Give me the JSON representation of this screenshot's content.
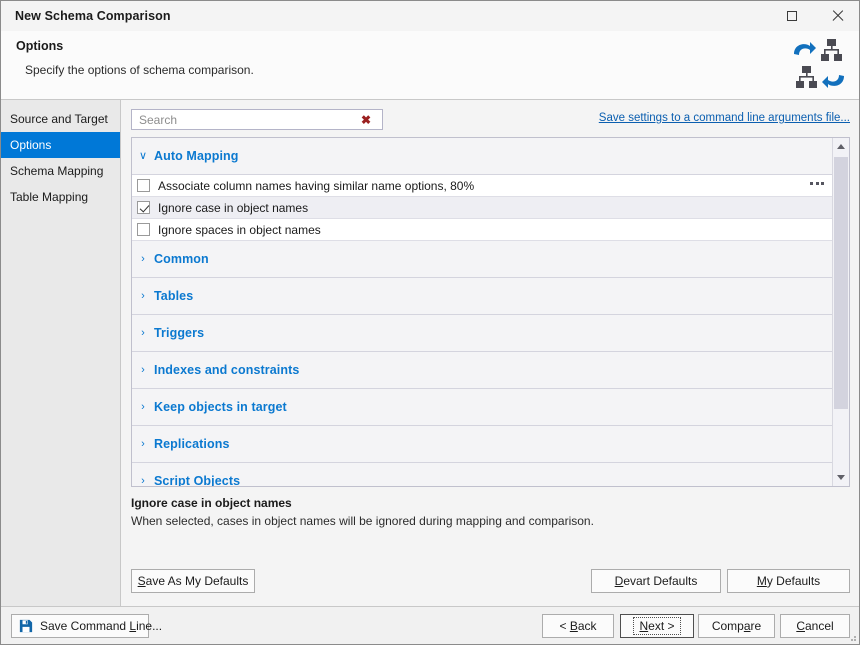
{
  "titlebar": {
    "title": "New Schema Comparison",
    "maximize_icon": "maximize-icon",
    "close_icon": "close-icon"
  },
  "header": {
    "title": "Options",
    "subtitle": "Specify the options of schema comparison.",
    "logo_icon": "schema-comparison-icon"
  },
  "sidebar": {
    "items": [
      {
        "label": "Source and Target",
        "active": false
      },
      {
        "label": "Options",
        "active": true
      },
      {
        "label": "Schema Mapping",
        "active": false
      },
      {
        "label": "Table Mapping",
        "active": false
      }
    ]
  },
  "toolbar": {
    "search": {
      "value": "",
      "placeholder": "Search",
      "clear_glyph": "✖"
    },
    "command_line_link": "Save settings to a command line arguments file..."
  },
  "options": {
    "groups": [
      {
        "label": "Auto Mapping",
        "expanded": true,
        "chevron": "∨",
        "rows": [
          {
            "label": "Associate column names having similar name options, 80%",
            "checked": false,
            "selected": false,
            "has_ellipsis": true
          },
          {
            "label": "Ignore case in object names",
            "checked": true,
            "selected": true,
            "has_ellipsis": false
          },
          {
            "label": "Ignore spaces in object names",
            "checked": false,
            "selected": false,
            "has_ellipsis": false
          }
        ]
      },
      {
        "label": "Common",
        "expanded": false,
        "chevron": "›",
        "rows": []
      },
      {
        "label": "Tables",
        "expanded": false,
        "chevron": "›",
        "rows": []
      },
      {
        "label": "Triggers",
        "expanded": false,
        "chevron": "›",
        "rows": []
      },
      {
        "label": "Indexes and constraints",
        "expanded": false,
        "chevron": "›",
        "rows": []
      },
      {
        "label": "Keep objects in target",
        "expanded": false,
        "chevron": "›",
        "rows": []
      },
      {
        "label": "Replications",
        "expanded": false,
        "chevron": "›",
        "rows": []
      },
      {
        "label": "Script Objects",
        "expanded": false,
        "chevron": "›",
        "rows": []
      }
    ],
    "scrollbar": {
      "up_icon": "scroll-up-icon",
      "down_icon": "scroll-down-icon"
    }
  },
  "description": {
    "title": "Ignore case in object names",
    "text": "When selected, cases in object names will be ignored during mapping and comparison."
  },
  "defaults_buttons": {
    "save_as_my_defaults": "Save As My Defaults",
    "save_as_my_defaults_accel": "S",
    "save_as_my_defaults_rest": "ave As My Defaults",
    "devart_defaults_accel": "D",
    "devart_defaults_pre": "",
    "devart_defaults_rest": "evart Defaults",
    "my_defaults_accel": "M",
    "my_defaults_rest": "y Defaults"
  },
  "footer": {
    "save_command_line_pre": "Save Command ",
    "save_command_line_accel": "L",
    "save_command_line_rest": "ine...",
    "save_icon": "save-floppy-icon",
    "back_pre": "< ",
    "back_accel": "B",
    "back_rest": "ack",
    "next_accel": "N",
    "next_rest": "ext >",
    "compare_pre": "Comp",
    "compare_accel": "a",
    "compare_rest": "re",
    "cancel_accel": "C",
    "cancel_rest": "ancel"
  },
  "colors": {
    "accent_blue": "#0078d7",
    "group_blue": "#0b79d0",
    "link_blue": "#0b5fb0",
    "clear_red": "#9b2020"
  }
}
